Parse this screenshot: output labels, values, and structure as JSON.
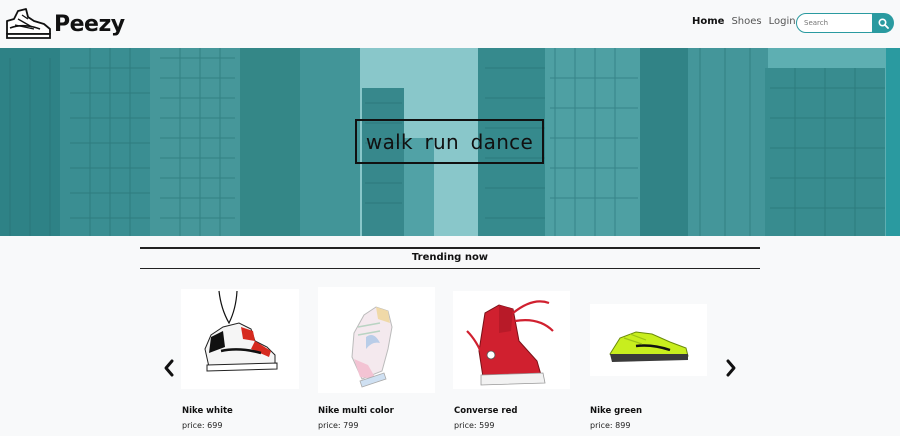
{
  "brand": {
    "name": "Peezy"
  },
  "nav": {
    "links": [
      {
        "label": "Home",
        "active": true
      },
      {
        "label": "Shoes",
        "active": false
      },
      {
        "label": "Login",
        "active": false
      }
    ],
    "basket_icon": "basket-icon",
    "search_placeholder": "Search",
    "search_icon": "search-icon"
  },
  "hero": {
    "tagline": "walk  run  dance"
  },
  "trending": {
    "title": "Trending now",
    "prev_icon": "chevron-left-icon",
    "next_icon": "chevron-right-icon",
    "products": [
      {
        "name": "Nike white",
        "price": "price: 699"
      },
      {
        "name": "Nike multi color",
        "price": "price: 799"
      },
      {
        "name": "Converse red",
        "price": "price: 599"
      },
      {
        "name": "Nike green",
        "price": "price: 899"
      }
    ]
  },
  "colors": {
    "accent": "#2a9aa0",
    "hero_tint": "#4d9ea2",
    "background": "#f8f9fa"
  }
}
